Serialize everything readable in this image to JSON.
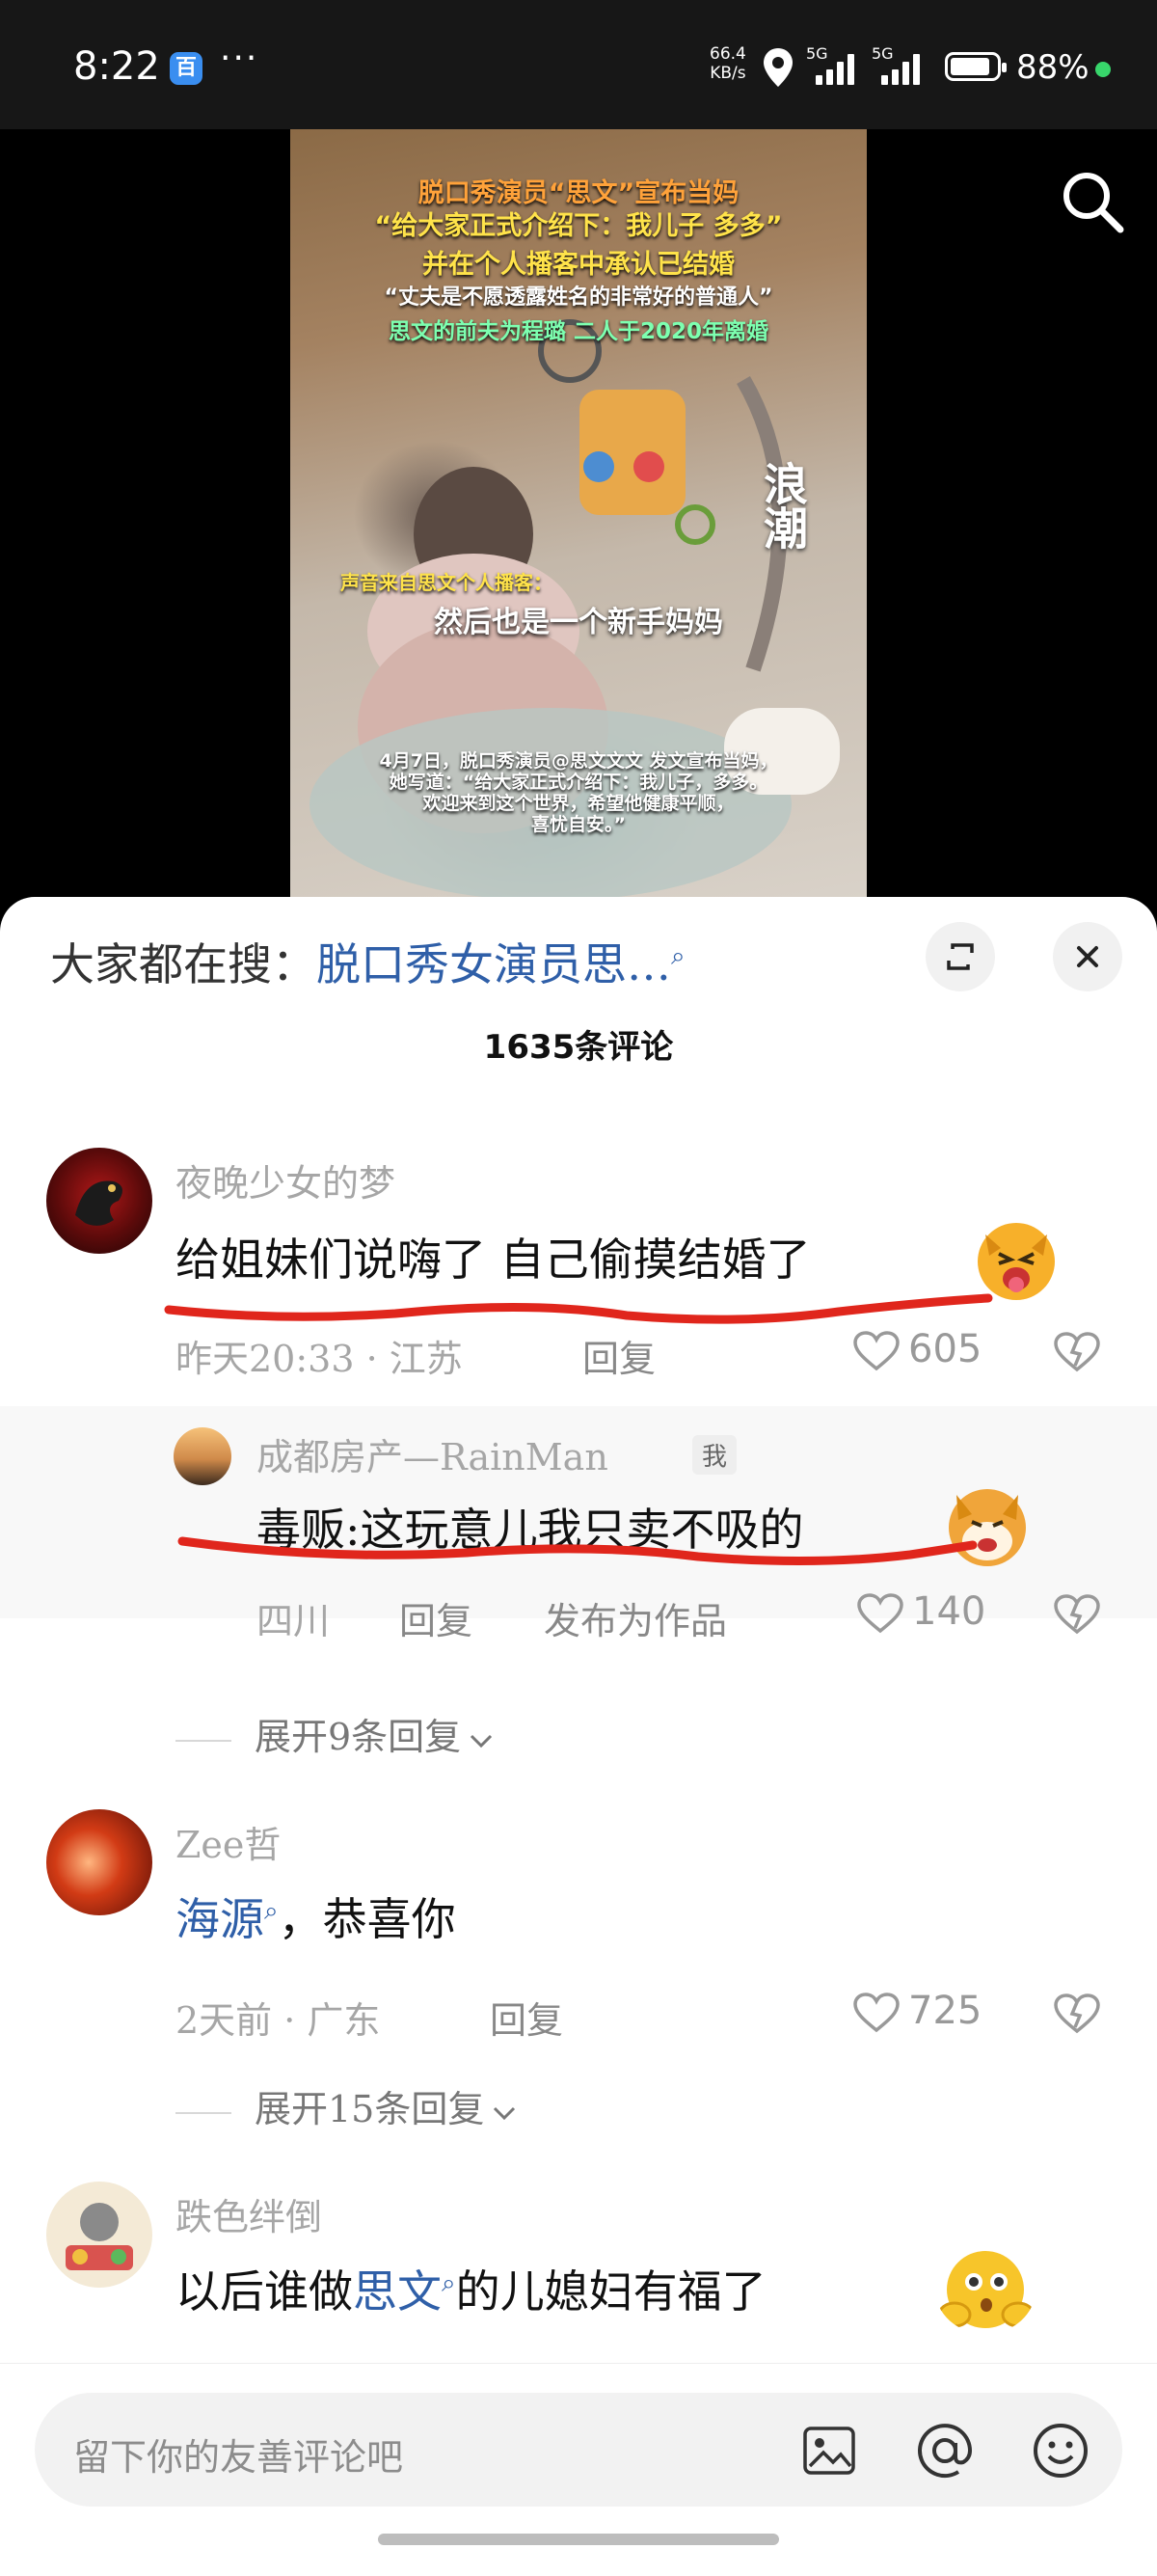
{
  "status": {
    "time": "8:22",
    "dots": "···",
    "speed_value": "66.4",
    "speed_unit": "KB/s",
    "net1": "5G",
    "net2": "5G",
    "battery_pct": "88%",
    "battery_level": 0.88,
    "app_icon_letter": "百"
  },
  "video": {
    "title_line1": "脱口秀演员“思文”宣布当妈",
    "title_line2": "“给大家正式介绍下：我儿子 多多”",
    "title_line3": "并在个人播客中承认已结婚",
    "title_line4": "“丈夫是不愿透露姓名的非常好的普通人”",
    "title_line5": "思文的前夫为程璐 二人于2020年离婚",
    "source_label": "声音来自思文个人播客：",
    "subtitle": "然后也是一个新手妈妈",
    "caption_line1": "4月7日，脱口秀演员@思文文文 发文宣布当妈，",
    "caption_line2": "她写道：“给大家正式介绍下：我儿子，多多。",
    "caption_line3": "欢迎来到这个世界，希望他健康平顺，",
    "caption_line4": "喜忧自安。”",
    "watermark": "浪潮"
  },
  "trending": {
    "prefix": "大家都在搜：",
    "keyword": "脱口秀女演员思…"
  },
  "comment_count": "1635条评论",
  "comments": [
    {
      "user": "夜晚少女的梦",
      "text": "给姐妹们说嗨了 自己偷摸结婚了",
      "time_loc": "昨天20:33 · 江苏",
      "reply_label": "回复",
      "likes": "605"
    },
    {
      "user": "Zee哲",
      "text_link": "海源",
      "text_rest": "，恭喜你",
      "time_loc": "2天前 · 广东",
      "reply_label": "回复",
      "likes": "725",
      "expand": "展开15条回复"
    },
    {
      "user": "跌色绊倒",
      "text_pre": "以后谁做",
      "text_link": "思文",
      "text_rest": "的儿媳妇有福了"
    }
  ],
  "reply": {
    "user": "成都房产—RainMan",
    "tag": "我",
    "text": "毒贩:这玩意儿我只卖不吸的",
    "location": "四川",
    "reply_label": "回复",
    "publish_label": "发布为作品",
    "likes": "140",
    "expand": "展开9条回复"
  },
  "input": {
    "placeholder": "留下你的友善评论吧"
  },
  "colors": {
    "link": "#2f5fa8",
    "underline": "#e0261c",
    "status_ok": "#38d66b"
  },
  "icons": [
    "search-icon",
    "expand-icon",
    "close-icon",
    "heart-icon",
    "dislike-heart-icon",
    "image-icon",
    "at-icon",
    "emoji-icon",
    "location-icon",
    "signal-icon",
    "battery-icon",
    "chevron-down-icon"
  ]
}
